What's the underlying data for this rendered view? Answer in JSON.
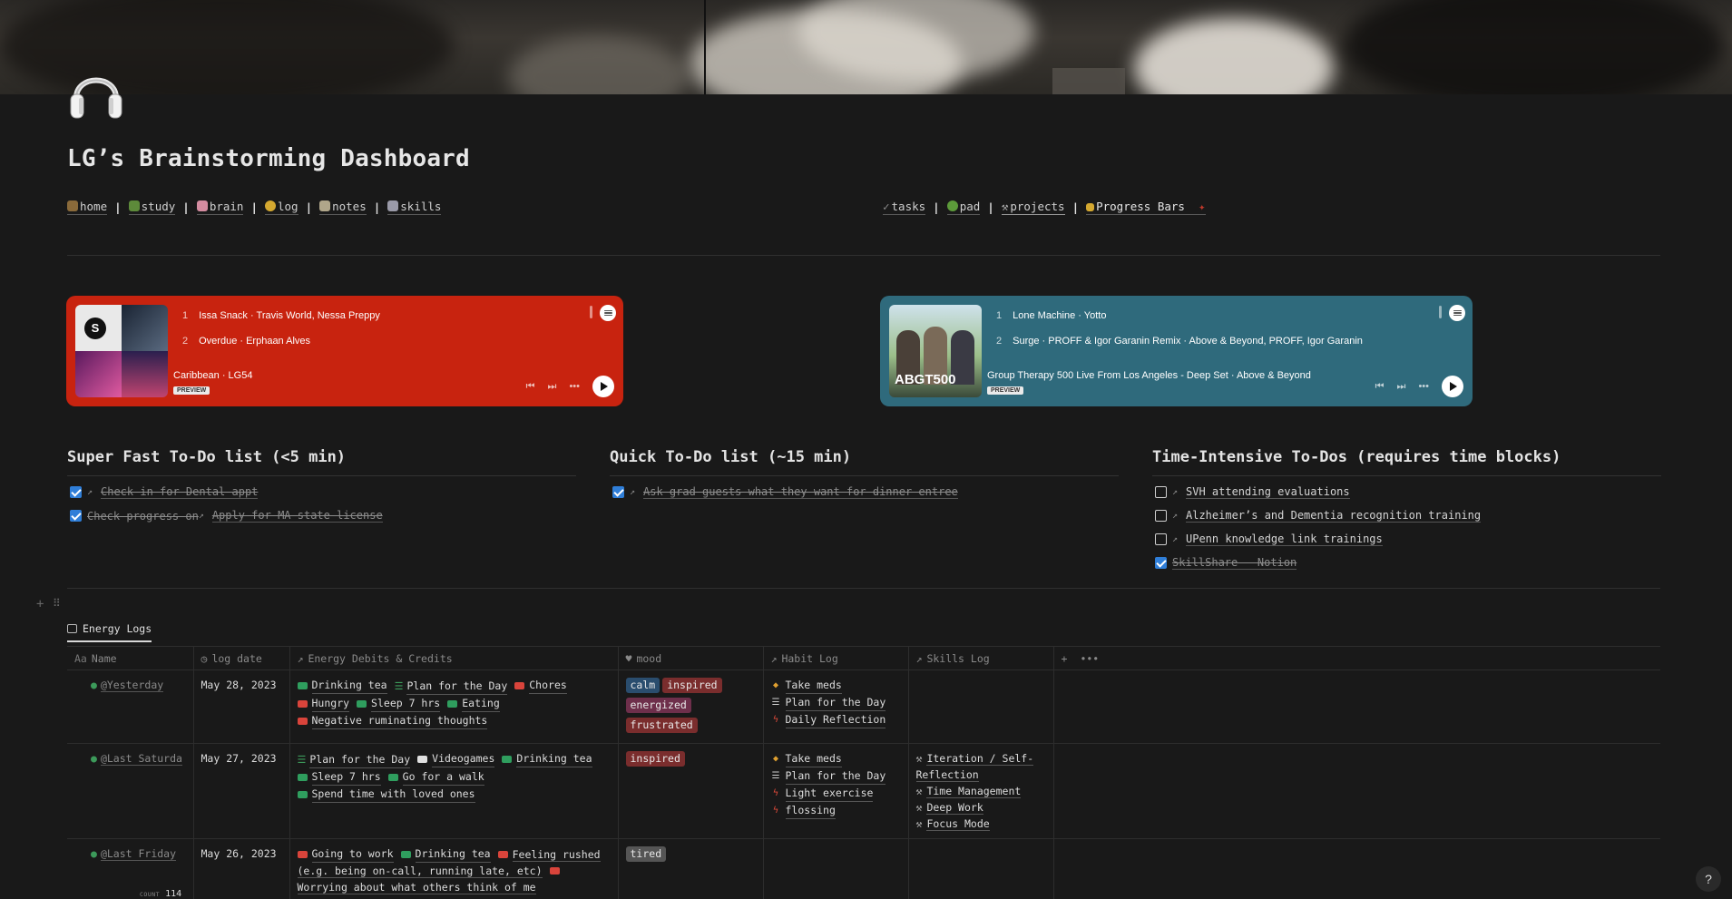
{
  "page": {
    "title": "LG’s Brainstorming Dashboard",
    "page_icon": "headphones-icon"
  },
  "nav_left": [
    {
      "label": "home",
      "icon": "house",
      "color": "#8a6a3a"
    },
    {
      "label": "study",
      "icon": "books",
      "color": "#5d8a3a"
    },
    {
      "label": "brain",
      "icon": "brain",
      "color": "#d48ca0"
    },
    {
      "label": "log",
      "icon": "face",
      "color": "#d4a830"
    },
    {
      "label": "notes",
      "icon": "memo",
      "color": "#b0a68a"
    },
    {
      "label": "skills",
      "icon": "chart",
      "color": "#9a9aa8"
    }
  ],
  "nav_right": [
    {
      "label": "tasks",
      "icon": "check",
      "color": "#777"
    },
    {
      "label": "pad",
      "icon": "tree",
      "color": "#5c9a3a"
    },
    {
      "label": "projects",
      "icon": "hammer",
      "color": "#888"
    },
    {
      "label": "Progress Bars",
      "icon": "progress",
      "color": "#d4a830"
    }
  ],
  "spotify": [
    {
      "bg": "#c8230f",
      "tracks": [
        {
          "n": "1",
          "title": "Issa Snack · Travis World, Nessa Preppy"
        },
        {
          "n": "2",
          "title": "Overdue · Erphaan Alves"
        }
      ],
      "album": "Caribbean · LG54",
      "preview": "PREVIEW"
    },
    {
      "bg": "#2f6a7c",
      "tracks": [
        {
          "n": "1",
          "title": "Lone Machine · Yotto"
        },
        {
          "n": "2",
          "title": "Surge · PROFF & Igor Garanin Remix · Above & Beyond, PROFF, Igor Garanin"
        }
      ],
      "album": "Group Therapy 500 Live From Los Angeles - Deep Set · Above & Beyond",
      "preview": "PREVIEW",
      "art_text": "ABGT500"
    }
  ],
  "todo_columns": [
    {
      "heading": "Super Fast To-Do list (<5 min)",
      "items": [
        {
          "prefix": "",
          "text": "Check in for Dental appt ",
          "checked": true
        },
        {
          "prefix": "Check progress on ",
          "text": "Apply for MA state license ",
          "checked": true
        }
      ]
    },
    {
      "heading": "Quick To-Do list (~15 min)",
      "items": [
        {
          "prefix": "",
          "text": "Ask grad guests what they want for dinner entree",
          "checked": true
        }
      ]
    },
    {
      "heading": "Time-Intensive To-Dos (requires  time blocks)",
      "items": [
        {
          "prefix": "",
          "text": "SVH attending evaluations",
          "checked": false
        },
        {
          "prefix": "",
          "text": "Alzheimer’s and Dementia recognition training",
          "checked": false
        },
        {
          "prefix": "",
          "text": "UPenn knowledge link trainings",
          "checked": false
        },
        {
          "prefix": "",
          "text": "SkillShare - Notion",
          "checked": true
        }
      ]
    }
  ],
  "database": {
    "tab": "Energy Logs",
    "columns": [
      "Name",
      "log date",
      "Energy Debits & Credits",
      "mood",
      "Habit Log",
      "Skills Log"
    ],
    "rows": [
      {
        "name": "@Yesterday",
        "date": "May 28, 2023",
        "energy": [
          {
            "t": "Drinking tea",
            "c": "#2f9e5e"
          },
          {
            "t": "Plan for the Day",
            "c": "list"
          },
          {
            "t": "Chores",
            "c": "#d9443b"
          },
          {
            "t": "Hungry",
            "c": "#d9443b"
          },
          {
            "t": "Sleep 7 hrs",
            "c": "#2f9e5e"
          },
          {
            "t": "Eating",
            "c": "#2f9e5e"
          },
          {
            "t": "Negative ruminating thoughts",
            "c": "#d9443b"
          }
        ],
        "mood": [
          {
            "t": "calm",
            "c": "#2a4d6e"
          },
          {
            "t": "inspired",
            "c": "#7a2d2d"
          },
          {
            "t": "energized",
            "c": "#6e2f4b"
          },
          {
            "t": "frustrated",
            "c": "#7a2d2d"
          }
        ],
        "habits": [
          {
            "t": "Take meds",
            "i": "pill"
          },
          {
            "t": "Plan for the Day",
            "i": "list"
          },
          {
            "t": "Daily Reflection",
            "i": "bolt"
          }
        ],
        "skills": []
      },
      {
        "name": "@Last Saturda",
        "date": "May 27, 2023",
        "energy": [
          {
            "t": "Plan for the Day",
            "c": "list"
          },
          {
            "t": "Videogames",
            "c": "#e0e0e0"
          },
          {
            "t": "Drinking tea",
            "c": "#2f9e5e"
          },
          {
            "t": "Sleep 7 hrs",
            "c": "#2f9e5e"
          },
          {
            "t": "Go for a walk",
            "c": "#2f9e5e"
          },
          {
            "t": "Spend time with loved ones",
            "c": "#2f9e5e"
          }
        ],
        "mood": [
          {
            "t": "inspired",
            "c": "#7a2d2d"
          }
        ],
        "habits": [
          {
            "t": "Take meds",
            "i": "pill"
          },
          {
            "t": "Plan for the Day",
            "i": "list"
          },
          {
            "t": "Light exercise",
            "i": "bolt"
          },
          {
            "t": "flossing",
            "i": "bolt"
          }
        ],
        "skills": [
          "Iteration / Self-Reflection",
          "Time Management",
          "Deep Work",
          "Focus Mode"
        ]
      },
      {
        "name": "@Last Friday",
        "date": "May 26, 2023",
        "energy": [
          {
            "t": "Going to work",
            "c": "#d9443b"
          },
          {
            "t": "Drinking tea",
            "c": "#2f9e5e"
          },
          {
            "t": "Feeling rushed (e.g. being on-call, running late, etc)",
            "c": "#d9443b"
          },
          {
            "t": "Worrying about what others think of me",
            "c": "#d9443b"
          }
        ],
        "mood": [
          {
            "t": "tired",
            "c": "#555555"
          }
        ],
        "habits": [],
        "skills": []
      }
    ],
    "count_label": "COUNT",
    "count": "114"
  },
  "help": "?"
}
